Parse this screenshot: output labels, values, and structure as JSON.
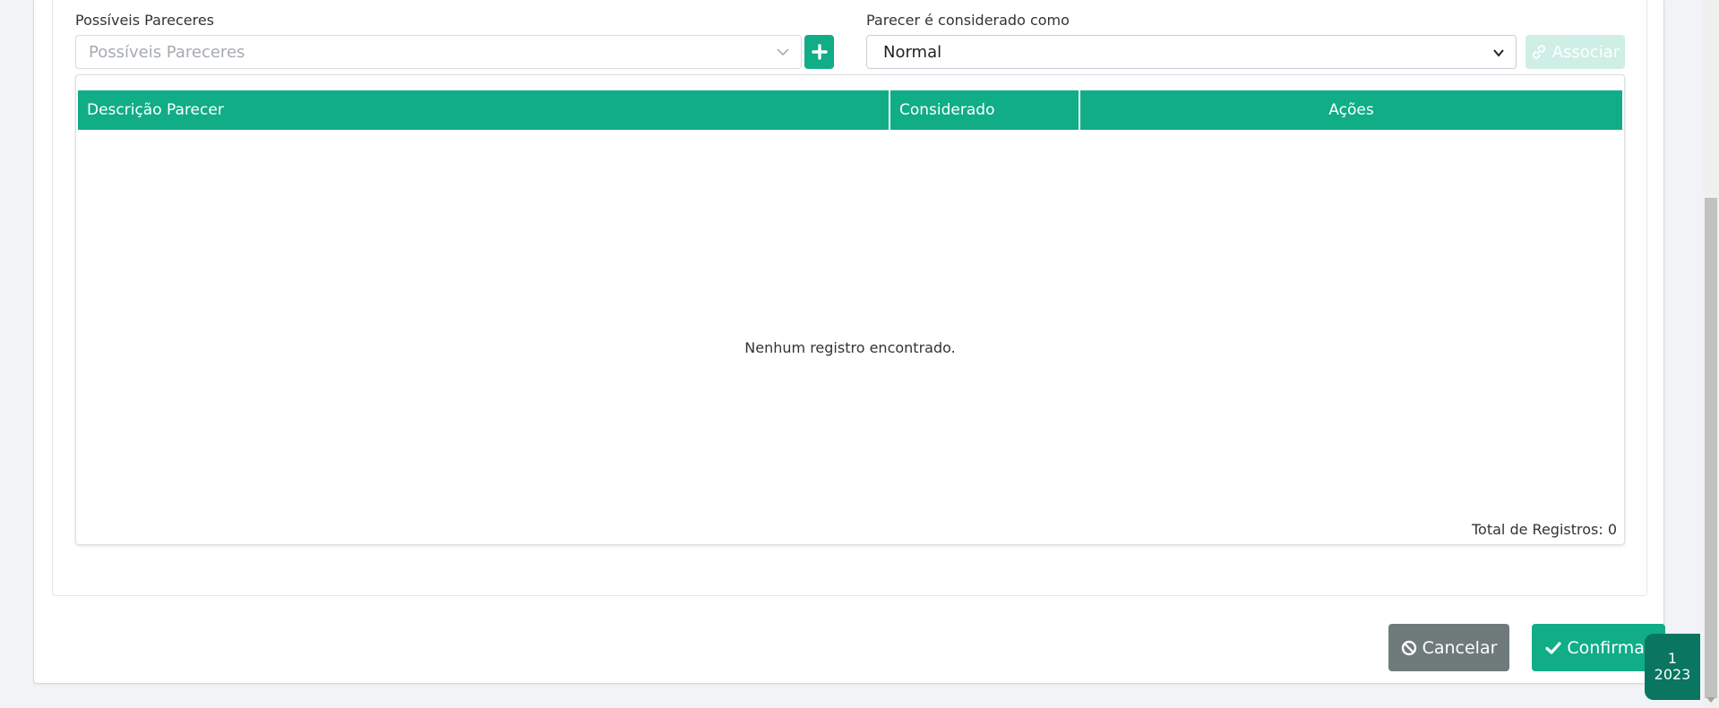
{
  "form": {
    "pareceres_label": "Possíveis Pareceres",
    "pareceres_placeholder": "Possíveis Pareceres",
    "considerado_label": "Parecer é considerado como",
    "considerado_value": "Normal",
    "associar_label": "Associar"
  },
  "table": {
    "columns": [
      "Descrição Parecer",
      "Considerado",
      "Ações"
    ],
    "empty_message": "Nenhum registro encontrado.",
    "total_label": "Total de Registros: 0"
  },
  "actions": {
    "cancel_label": "Cancelar",
    "confirm_label": "Confirmar"
  },
  "badge": {
    "line1": "1",
    "line2": "2023"
  },
  "colors": {
    "primary": "#10ad87",
    "cancel": "#6f7a7b",
    "badge": "#0a7560"
  }
}
